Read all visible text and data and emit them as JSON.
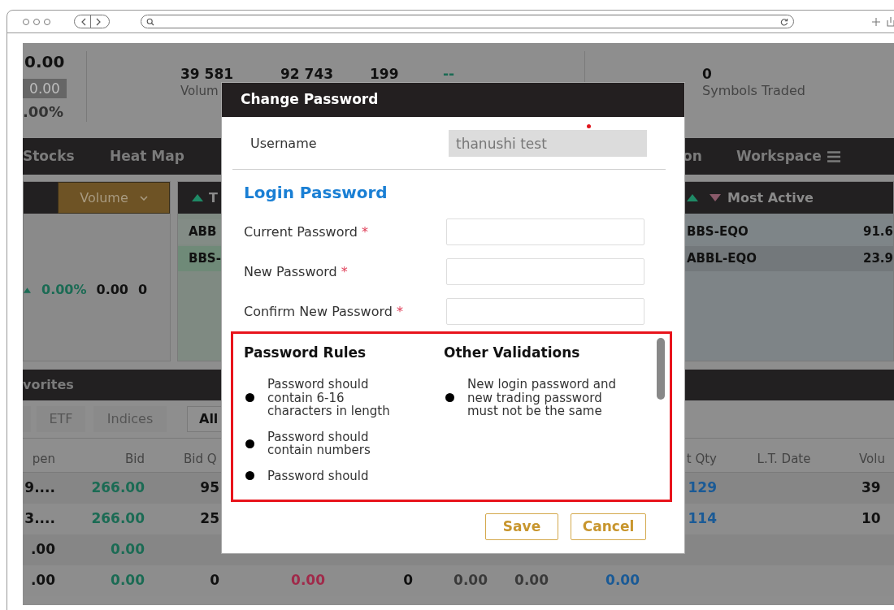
{
  "header": {
    "last": "0.00",
    "change": "0.00",
    "percent": ".00%",
    "stats": [
      "39 581",
      "92 743",
      "199",
      "--"
    ],
    "stat_label": "Volum",
    "symbols": {
      "value": "0",
      "label": "Symbols Traded"
    }
  },
  "nav": {
    "left_items": [
      "Stocks",
      "Heat Map"
    ],
    "right_items": [
      "on",
      "Workspace"
    ]
  },
  "index_panel": {
    "sort": "Volume",
    "row": [
      "0.00%",
      "0.00",
      "0"
    ]
  },
  "gainers_panel": {
    "title": "T",
    "rows": [
      {
        "symbol": "ABB",
        "selected": false
      },
      {
        "symbol": "BBS-",
        "selected": true
      }
    ]
  },
  "most_active": {
    "title": "Most Active",
    "rows": [
      {
        "symbol": "BBS-EQO",
        "price": "91.6",
        "selected": false
      },
      {
        "symbol": "ABBL-EQO",
        "price": "23.9",
        "selected": true
      }
    ]
  },
  "favorites": {
    "title": "vorites",
    "filters": [
      {
        "label": "ETF",
        "selected": false
      },
      {
        "label": "Indices",
        "selected": false
      },
      {
        "label": "All",
        "selected": true
      }
    ]
  },
  "table": {
    "left_columns": [
      "pen",
      "Bid",
      "Bid Q"
    ],
    "right_columns": [
      "t Qty",
      "L.T. Date",
      "Volu"
    ],
    "rows": [
      {
        "left": [
          {
            "text": "9....",
            "kind": "plain"
          },
          {
            "text": "266.00",
            "kind": "up"
          },
          {
            "text": "95",
            "kind": "plain"
          }
        ],
        "right": [
          {
            "text": "129",
            "kind": "link"
          },
          {
            "text": "39",
            "kind": "plain"
          }
        ]
      },
      {
        "left": [
          {
            "text": "3....",
            "kind": "plain"
          },
          {
            "text": "266.00",
            "kind": "up"
          },
          {
            "text": "25",
            "kind": "plain"
          }
        ],
        "right": [
          {
            "text": "114",
            "kind": "link"
          },
          {
            "text": "10",
            "kind": "plain"
          }
        ]
      },
      {
        "left": [
          {
            "text": ".00",
            "kind": "plain"
          },
          {
            "text": "0.00",
            "kind": "up"
          }
        ]
      },
      {
        "left": [
          {
            "text": ".00",
            "kind": "plain"
          },
          {
            "text": "0.00",
            "kind": "up"
          },
          {
            "text": "0",
            "kind": "plain"
          }
        ],
        "middle": [
          {
            "text": "0.00",
            "kind": "down"
          },
          {
            "text": "0",
            "kind": "plain"
          },
          {
            "text": "0.00",
            "kind": "muted"
          },
          {
            "text": "0.00",
            "kind": "muted"
          },
          {
            "text": "0.00",
            "kind": "link"
          }
        ]
      }
    ]
  },
  "dialog": {
    "title": "Change Password",
    "username": {
      "label": "Username",
      "value": "thanushi test",
      "disabled": true
    },
    "section_title": "Login Password",
    "fields": [
      {
        "label": "Current Password",
        "marker": "*"
      },
      {
        "label": "New Password",
        "marker": "*"
      },
      {
        "label": "Confirm New Password",
        "marker": "*"
      }
    ],
    "rules": {
      "title": "Password Rules",
      "items": [
        "Password should contain 6-16 characters in length",
        "Password should contain numbers",
        "Password should"
      ]
    },
    "validations": {
      "title": "Other Validations",
      "items": [
        "New login password and new trading password must not be the same"
      ]
    },
    "buttons": [
      "Save",
      "Cancel"
    ]
  }
}
